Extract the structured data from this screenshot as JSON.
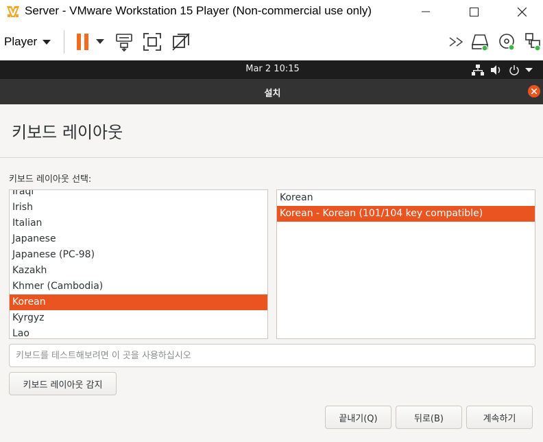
{
  "window": {
    "title": "Server - VMware Workstation 15 Player (Non-commercial use only)"
  },
  "toolbar": {
    "player_menu": "Player",
    "icons": [
      "pause-icon",
      "dropdown-arrow-icon",
      "send-ctrl-alt-del-icon",
      "fit-guest-icon",
      "unity-icon",
      "more-icon",
      "hard-disk-icon",
      "cd-dvd-icon",
      "network-adapter-icon"
    ]
  },
  "ubuntu_bar": {
    "clock": "Mar 2  10:15"
  },
  "installer": {
    "title": "설치",
    "heading": "키보드 레이아웃",
    "select_label": "키보드 레이아웃 선택:",
    "layouts": [
      "Iraqi",
      "Irish",
      "Italian",
      "Japanese",
      "Japanese (PC-98)",
      "Kazakh",
      "Khmer (Cambodia)",
      "Korean",
      "Kyrgyz",
      "Lao"
    ],
    "layouts_selected": "Korean",
    "variants": [
      "Korean",
      "Korean - Korean (101/104 key compatible)"
    ],
    "variants_selected": "Korean - Korean (101/104 key compatible)",
    "test_placeholder": "키보드를 테스트해보려면 이 곳을 사용하십시오",
    "test_value": "",
    "detect_button": "키보드 레이아웃 감지",
    "quit_button": "끝내기(Q)",
    "back_button": "뒤로(B)",
    "continue_button": "계속하기"
  },
  "colors": {
    "accent": "#e95420",
    "vmware_pause": "#f26b21",
    "status_green": "#3cb649"
  }
}
